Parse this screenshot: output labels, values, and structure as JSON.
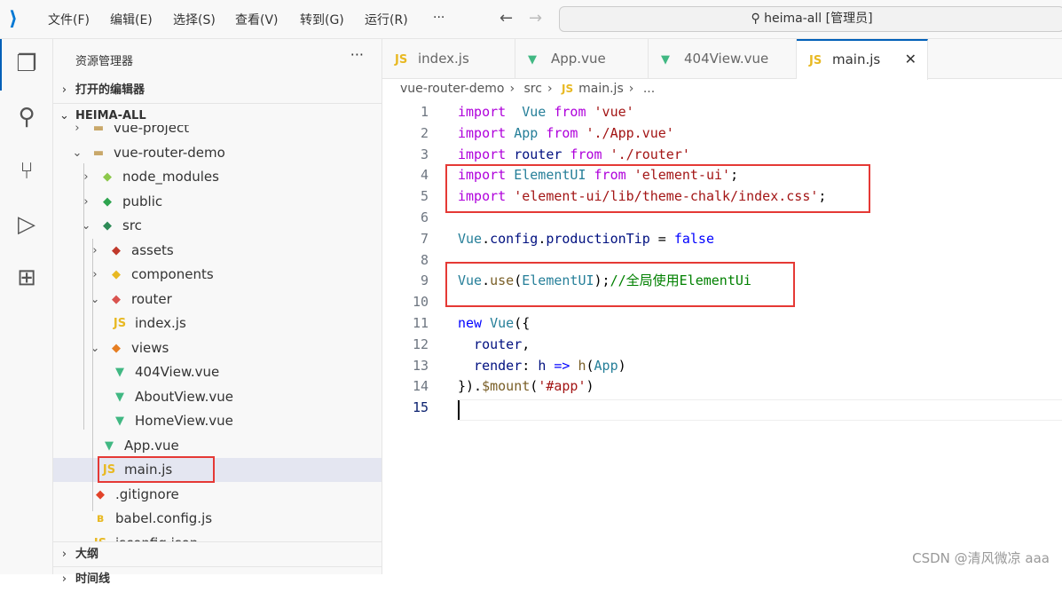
{
  "titlebar": {
    "menus": [
      "文件(F)",
      "编辑(E)",
      "选择(S)",
      "查看(V)",
      "转到(G)",
      "运行(R)",
      "···"
    ],
    "search": "heima-all [管理员]"
  },
  "sidebar": {
    "title": "资源管理器",
    "more": "···",
    "open_editors": "打开的编辑器",
    "workspace": "HEIMA-ALL",
    "outline": "大纲",
    "timeline": "时间线",
    "tree": [
      {
        "label": "vue-project",
        "depth": 1,
        "chev": ">",
        "icon": "folder"
      },
      {
        "label": "vue-router-demo",
        "depth": 1,
        "chev": "v",
        "icon": "folder"
      },
      {
        "label": "node_modules",
        "depth": 2,
        "chev": ">",
        "icon": "node-folder"
      },
      {
        "label": "public",
        "depth": 2,
        "chev": ">",
        "icon": "public-folder"
      },
      {
        "label": "src",
        "depth": 2,
        "chev": "v",
        "icon": "src-folder"
      },
      {
        "label": "assets",
        "depth": 3,
        "chev": ">",
        "icon": "assets-folder"
      },
      {
        "label": "components",
        "depth": 3,
        "chev": ">",
        "icon": "components-folder"
      },
      {
        "label": "router",
        "depth": 3,
        "chev": "v",
        "icon": "router-folder"
      },
      {
        "label": "index.js",
        "depth": 4,
        "chev": "",
        "icon": "js"
      },
      {
        "label": "views",
        "depth": 3,
        "chev": "v",
        "icon": "views-folder"
      },
      {
        "label": "404View.vue",
        "depth": 4,
        "chev": "",
        "icon": "vue"
      },
      {
        "label": "AboutView.vue",
        "depth": 4,
        "chev": "",
        "icon": "vue"
      },
      {
        "label": "HomeView.vue",
        "depth": 4,
        "chev": "",
        "icon": "vue"
      },
      {
        "label": "App.vue",
        "depth": 3,
        "chev": "",
        "icon": "vue"
      },
      {
        "label": "main.js",
        "depth": 3,
        "chev": "",
        "icon": "js",
        "selected": true
      },
      {
        "label": ".gitignore",
        "depth": 2,
        "chev": "",
        "icon": "git"
      },
      {
        "label": "babel.config.js",
        "depth": 2,
        "chev": "",
        "icon": "babel"
      },
      {
        "label": "jsconfig.json",
        "depth": 2,
        "chev": "",
        "icon": "js"
      }
    ]
  },
  "tabs": [
    {
      "label": "index.js",
      "icon": "js"
    },
    {
      "label": "App.vue",
      "icon": "vue"
    },
    {
      "label": "404View.vue",
      "icon": "vue"
    },
    {
      "label": "main.js",
      "icon": "js",
      "active": true,
      "close": "✕"
    }
  ],
  "breadcrumb": [
    "vue-router-demo",
    "src",
    "main.js",
    "..."
  ],
  "code": [
    [
      [
        "kw",
        "import"
      ],
      [
        "",
        "  "
      ],
      [
        "cls",
        "Vue"
      ],
      [
        "",
        ""
      ],
      [
        "kw",
        " from"
      ],
      [
        "str",
        " 'vue'"
      ]
    ],
    [
      [
        "kw",
        "import"
      ],
      [
        "",
        " "
      ],
      [
        "cls",
        "App"
      ],
      [
        "kw",
        " from"
      ],
      [
        "str",
        " './App.vue'"
      ]
    ],
    [
      [
        "kw",
        "import"
      ],
      [
        "",
        " "
      ],
      [
        "id",
        "router"
      ],
      [
        "kw",
        " from"
      ],
      [
        "str",
        " './router'"
      ]
    ],
    [
      [
        "kw",
        "import"
      ],
      [
        "",
        " "
      ],
      [
        "cls",
        "ElementUI"
      ],
      [
        "kw",
        " from"
      ],
      [
        "str",
        " 'element-ui'"
      ],
      [
        "",
        ";"
      ]
    ],
    [
      [
        "kw",
        "import"
      ],
      [
        "str",
        " 'element-ui/lib/theme-chalk/index.css'"
      ],
      [
        "",
        ";"
      ]
    ],
    [],
    [
      [
        "cls",
        "Vue"
      ],
      [
        "",
        "."
      ],
      [
        "id",
        "config"
      ],
      [
        "",
        "."
      ],
      [
        "id",
        "productionTip"
      ],
      [
        "",
        " = "
      ],
      [
        "bool",
        "false"
      ]
    ],
    [],
    [
      [
        "cls",
        "Vue"
      ],
      [
        "",
        "."
      ],
      [
        "fn",
        "use"
      ],
      [
        "",
        "("
      ],
      [
        "cls",
        "ElementUI"
      ],
      [
        "",
        ");"
      ],
      [
        "cm",
        "//全局使用ElementUi"
      ]
    ],
    [],
    [
      [
        "bool",
        "new"
      ],
      [
        "",
        " "
      ],
      [
        "cls",
        "Vue"
      ],
      [
        "",
        "({"
      ]
    ],
    [
      [
        "",
        ""
      ],
      [
        "id",
        "  router"
      ],
      [
        "",
        ","
      ]
    ],
    [
      [
        "id",
        "  render"
      ],
      [
        "",
        ": "
      ],
      [
        "id",
        "h"
      ],
      [
        "bool",
        " =>"
      ],
      [
        "",
        " "
      ],
      [
        "fn",
        "h"
      ],
      [
        "",
        "("
      ],
      [
        "cls",
        "App"
      ],
      [
        "",
        ")"
      ]
    ],
    [
      [
        "",
        "})."
      ],
      [
        "fn",
        "$mount"
      ],
      [
        "",
        "("
      ],
      [
        "str",
        "'#app'"
      ],
      [
        "",
        ")"
      ]
    ],
    []
  ],
  "watermark": "CSDN @清风微凉 aaa"
}
